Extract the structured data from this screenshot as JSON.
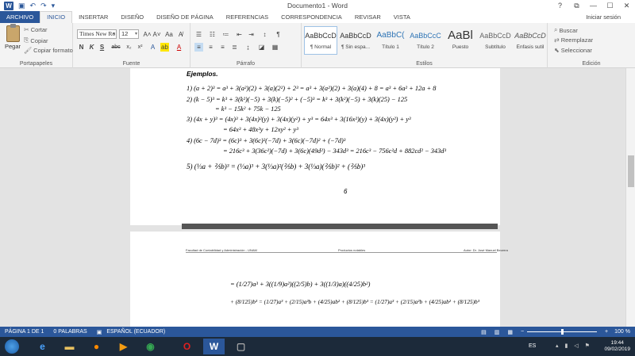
{
  "window": {
    "title": "Documento1 - Word",
    "controls": [
      "?",
      "⧉",
      "—",
      "☐",
      "✕"
    ]
  },
  "qat": {
    "icons": [
      "save-icon",
      "undo-icon",
      "redo-icon",
      "customize-icon"
    ]
  },
  "tabs": [
    {
      "label": "ARCHIVO"
    },
    {
      "label": "INICIO"
    },
    {
      "label": "INSERTAR"
    },
    {
      "label": "DISEÑO"
    },
    {
      "label": "DISEÑO DE PÁGINA"
    },
    {
      "label": "REFERENCIAS"
    },
    {
      "label": "CORRESPONDENCIA"
    },
    {
      "label": "REVISAR"
    },
    {
      "label": "VISTA"
    }
  ],
  "signin": "Iniciar sesión",
  "ribbon": {
    "clipboard": {
      "paste": "Pegar",
      "cut": "Cortar",
      "copy": "Copiar",
      "format_painter": "Copiar formato",
      "label": "Portapapeles"
    },
    "font": {
      "name": "Times New Ro",
      "size": "12",
      "label": "Fuente",
      "buttons": [
        "N",
        "K",
        "S",
        "abc",
        "x₂",
        "x²"
      ]
    },
    "paragraph": {
      "label": "Párrafo"
    },
    "styles": {
      "label": "Estilos",
      "items": [
        {
          "preview": "AaBbCcD",
          "name": "¶ Normal"
        },
        {
          "preview": "AaBbCcD",
          "name": "¶ Sin espa..."
        },
        {
          "preview": "AaBbC(",
          "name": "Título 1"
        },
        {
          "preview": "AaBbCcC",
          "name": "Título 2"
        },
        {
          "preview": "AaBl",
          "name": "Puesto"
        },
        {
          "preview": "AaBbCcD",
          "name": "Subtítulo"
        },
        {
          "preview": "AaBbCcD",
          "name": "Énfasis sutil"
        }
      ]
    },
    "editing": {
      "label": "Edición",
      "find": "Buscar",
      "replace": "Reemplazar",
      "select": "Seleccionar"
    }
  },
  "doc": {
    "heading": "Ejemplos.",
    "lines": [
      "1)  (a + 2)³ = a³ + 3(a²)(2) + 3(a)(2²) + 2³ = a³ + 3(a²)(2) + 3(a)(4) + 8 = a³ + 6a² + 12a + 8",
      "2)  (k − 5)³ = k³ + 3(k²)(−5) + 3(k)(−5)² + (−5)³ = k³ + 3(k²)(−5) + 3(k)(25) − 125",
      "= k³ − 15k² + 75k − 125",
      "3)  (4x + y)³ = (4x)³ + 3(4x)²(y) + 3(4x)(y²) + y³ = 64x³ + 3(16x²)(y) + 3(4x)(y²) + y³",
      "= 64x³ + 48x²y + 12xy² + y³",
      "4)  (6c − 7d)³ = (6c)³ + 3(6c)²(−7d) + 3(6c)(−7d)² + (−7d)³",
      "= 216c³ + 3(36c²)(−7d) + 3(6c)(49d²) − 343d³ = 216c³ − 756c²d + 882cd² − 343d³",
      "5)  (⅓a + ⅖b)³ = (⅓a)³ + 3(⅓a)²(⅖b) + 3(⅓a)(⅖b)² + (⅖b)³"
    ],
    "page_number": "6",
    "header_left": "Facultad de Contabilidad y Administración - UNAM",
    "header_center": "Productos notables",
    "header_right": "Autor: Dr. José Manuel Becerra",
    "page2_lines": [
      "= (1/27)a³ + 3((1/9)a²)((2/5)b) + 3((1/3)a)((4/25)b²)",
      "+ (8/125)b³ = (1/27)a³ + (2/15)a²b + (4/25)ab² + (8/125)b³ = (1/27)a³ + (2/15)a²b + (4/25)ab² + (8/125)b³"
    ]
  },
  "status": {
    "page": "PÁGINA 1 DE 1",
    "words": "0 PALABRAS",
    "lang": "ESPAÑOL (ECUADOR)",
    "zoom": "100 %",
    "zoom_level": 1.0
  },
  "taskbar": {
    "lang": "ES",
    "time": "19:44",
    "date": "09/02/2019",
    "apps": [
      "explorer-icon",
      "ie-icon",
      "folder-icon",
      "firefox-icon",
      "media-icon",
      "chrome-icon",
      "opera-icon",
      "word-icon",
      "unknown-icon"
    ]
  }
}
